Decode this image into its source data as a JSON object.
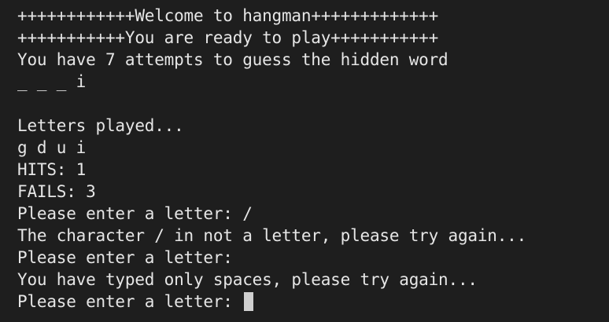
{
  "terminal": {
    "lines": {
      "banner_welcome": "++++++++++++Welcome to hangman+++++++++++++",
      "banner_ready": "+++++++++++You are ready to play+++++++++++",
      "attempts_info": "You have 7 attempts to guess the hidden word",
      "word_progress": "_ _ _ i",
      "letters_played_label": "Letters played...",
      "letters_played": "g d u i",
      "hits": "HITS: 1",
      "fails": "FAILS: 3",
      "prompt_1": "Please enter a letter: /",
      "error_not_letter": "The character / in not a letter, please try again...",
      "prompt_2": "Please enter a letter: ",
      "error_spaces": "You have typed only spaces, please try again...",
      "prompt_3": "Please enter a letter: "
    },
    "colors": {
      "background": "#1e1e1e",
      "text": "#e6e6e6",
      "cursor": "#cfcfcf"
    }
  }
}
